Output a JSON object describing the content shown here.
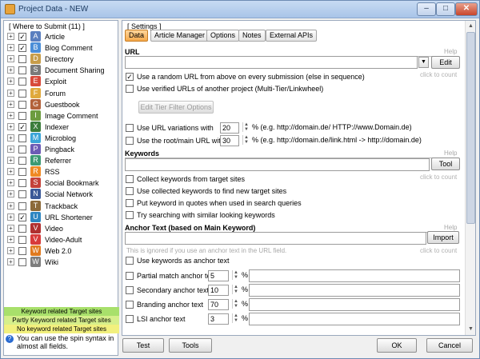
{
  "window": {
    "title": "Project Data - NEW"
  },
  "left": {
    "header": "[ Where to Submit  (11) ]",
    "items": [
      {
        "label": "Article",
        "checked": true,
        "icon": "article-icon",
        "color": "#5a7fbf",
        "glyph": "A"
      },
      {
        "label": "Blog Comment",
        "checked": true,
        "icon": "blog-comment-icon",
        "color": "#4b8ed8",
        "glyph": "B"
      },
      {
        "label": "Directory",
        "checked": false,
        "icon": "directory-icon",
        "color": "#c79d4a",
        "glyph": "D"
      },
      {
        "label": "Document Sharing",
        "checked": false,
        "icon": "document-sharing-icon",
        "color": "#7a7a7a",
        "glyph": "S"
      },
      {
        "label": "Exploit",
        "checked": false,
        "icon": "exploit-icon",
        "color": "#d84a3b",
        "glyph": "E"
      },
      {
        "label": "Forum",
        "checked": false,
        "icon": "forum-icon",
        "color": "#e0a93c",
        "glyph": "F"
      },
      {
        "label": "Guestbook",
        "checked": false,
        "icon": "guestbook-icon",
        "color": "#b3623b",
        "glyph": "G"
      },
      {
        "label": "Image Comment",
        "checked": false,
        "icon": "image-comment-icon",
        "color": "#6c9c3f",
        "glyph": "I"
      },
      {
        "label": "Indexer",
        "checked": true,
        "icon": "indexer-icon",
        "color": "#3c7d3c",
        "glyph": "X"
      },
      {
        "label": "Microblog",
        "checked": false,
        "icon": "microblog-icon",
        "color": "#3aa5d8",
        "glyph": "M"
      },
      {
        "label": "Pingback",
        "checked": false,
        "icon": "pingback-icon",
        "color": "#6c5bb5",
        "glyph": "P"
      },
      {
        "label": "Referrer",
        "checked": false,
        "icon": "referrer-icon",
        "color": "#3d9a74",
        "glyph": "R"
      },
      {
        "label": "RSS",
        "checked": false,
        "icon": "rss-icon",
        "color": "#f08a24",
        "glyph": "R"
      },
      {
        "label": "Social Bookmark",
        "checked": false,
        "icon": "social-bookmark-icon",
        "color": "#c4423a",
        "glyph": "S"
      },
      {
        "label": "Social Network",
        "checked": false,
        "icon": "social-network-icon",
        "color": "#3b5998",
        "glyph": "N"
      },
      {
        "label": "Trackback",
        "checked": false,
        "icon": "trackback-icon",
        "color": "#8c6a3a",
        "glyph": "T"
      },
      {
        "label": "URL Shortener",
        "checked": true,
        "icon": "url-shortener-icon",
        "color": "#2e86c1",
        "glyph": "U"
      },
      {
        "label": "Video",
        "checked": false,
        "icon": "video-icon",
        "color": "#b03030",
        "glyph": "V"
      },
      {
        "label": "Video-Adult",
        "checked": false,
        "icon": "video-adult-icon",
        "color": "#d83b3b",
        "glyph": "V"
      },
      {
        "label": "Web 2.0",
        "checked": false,
        "icon": "web20-icon",
        "color": "#e07a1f",
        "glyph": "W"
      },
      {
        "label": "Wiki",
        "checked": false,
        "icon": "wiki-icon",
        "color": "#7d7d7d",
        "glyph": "W"
      }
    ],
    "legend": [
      "Keyword related Target sites",
      "Partly Keyword related Target sites",
      "No keyword related Target sites"
    ],
    "hint": "You can use the spin syntax in almost all fields."
  },
  "settings": {
    "header": "[ Settings ]",
    "tabs": [
      "Data",
      "Article Manager",
      "Options",
      "Notes",
      "External APIs"
    ],
    "url": {
      "title": "URL",
      "help": "Help",
      "click": "click to count",
      "edit": "Edit",
      "random": "Use a random URL from above on every submission (else in sequence)",
      "verified": "Use verified URLs of another project (Multi-Tier/Linkwheel)",
      "filter": "Edit Tier Filter Options",
      "variations": "Use URL variations with",
      "variations_val": "20",
      "variations_eg": "(e.g. http://domain.de/ HTTP://www.Domain.de)",
      "root": "Use the root/main URL with",
      "root_val": "30",
      "root_eg": "(e.g. http://domain.de/link.html -> http://domain.de)"
    },
    "keywords": {
      "title": "Keywords",
      "help": "Help",
      "click": "click to count",
      "tool": "Tool",
      "opts": [
        "Collect keywords from target sites",
        "Use collected keywords to find new target sites",
        "Put keyword in quotes when used in search queries",
        "Try searching with similar looking keywords"
      ]
    },
    "anchor": {
      "title": "Anchor Text (based on Main Keyword)",
      "help": "Help",
      "import": "Import",
      "note": "This is ignored if you use an anchor text in the URL field.",
      "click": "click to count",
      "use_kw": "Use keywords as anchor text",
      "rows": [
        {
          "label": "Partial match anchor text",
          "value": "5"
        },
        {
          "label": "Secondary anchor text",
          "value": "10"
        },
        {
          "label": "Branding anchor text",
          "value": "70"
        },
        {
          "label": "LSI anchor text",
          "value": "3"
        }
      ],
      "pct": "%"
    }
  },
  "bottom": {
    "test": "Test",
    "tools": "Tools",
    "ok": "OK",
    "cancel": "Cancel"
  }
}
